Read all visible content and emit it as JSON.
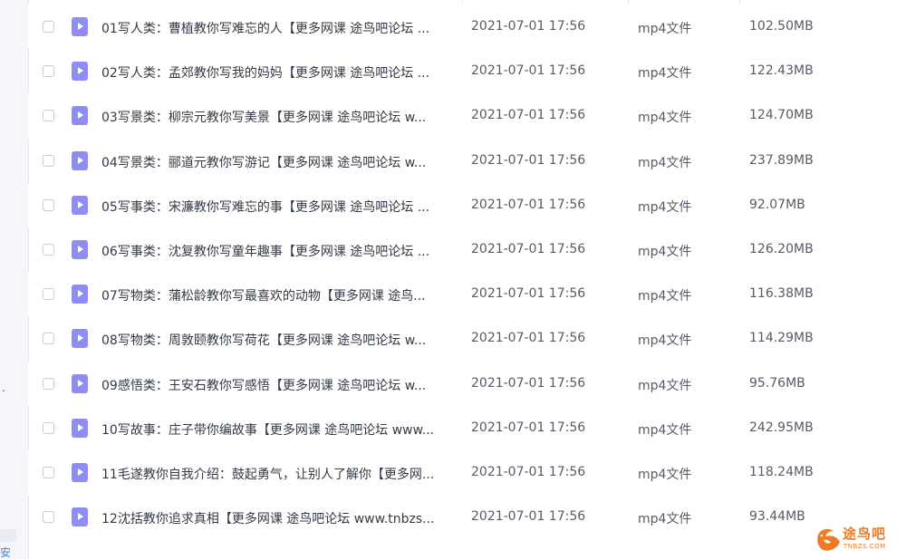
{
  "left_panel": {
    "dot": ".",
    "bottom_text": "安"
  },
  "files": [
    {
      "name": "01写人类：曹植教你写难忘的人【更多网课 途鸟吧论坛 ...",
      "date": "2021-07-01 17:56",
      "type": "mp4文件",
      "size": "102.50MB"
    },
    {
      "name": "02写人类：孟郊教你写我的妈妈【更多网课 途鸟吧论坛 ...",
      "date": "2021-07-01 17:56",
      "type": "mp4文件",
      "size": "122.43MB"
    },
    {
      "name": "03写景类：柳宗元教你写美景【更多网课 途鸟吧论坛 w...",
      "date": "2021-07-01 17:56",
      "type": "mp4文件",
      "size": "124.70MB"
    },
    {
      "name": "04写景类：郦道元教你写游记【更多网课 途鸟吧论坛 w...",
      "date": "2021-07-01 17:56",
      "type": "mp4文件",
      "size": "237.89MB"
    },
    {
      "name": "05写事类：宋濂教你写难忘的事【更多网课 途鸟吧论坛 ...",
      "date": "2021-07-01 17:56",
      "type": "mp4文件",
      "size": "92.07MB"
    },
    {
      "name": "06写事类：沈复教你写童年趣事【更多网课 途鸟吧论坛 ...",
      "date": "2021-07-01 17:56",
      "type": "mp4文件",
      "size": "126.20MB"
    },
    {
      "name": "07写物类：蒲松龄教你写最喜欢的动物【更多网课 途鸟...",
      "date": "2021-07-01 17:56",
      "type": "mp4文件",
      "size": "116.38MB"
    },
    {
      "name": "08写物类：周敦颐教你写荷花【更多网课 途鸟吧论坛 w...",
      "date": "2021-07-01 17:56",
      "type": "mp4文件",
      "size": "114.29MB"
    },
    {
      "name": "09感悟类：王安石教你写感悟【更多网课 途鸟吧论坛 w...",
      "date": "2021-07-01 17:56",
      "type": "mp4文件",
      "size": "95.76MB"
    },
    {
      "name": "10写故事：庄子带你编故事【更多网课 途鸟吧论坛 www...",
      "date": "2021-07-01 17:56",
      "type": "mp4文件",
      "size": "242.95MB"
    },
    {
      "name": "11毛遂教你自我介绍：鼓起勇气，让别人了解你【更多网...",
      "date": "2021-07-01 17:56",
      "type": "mp4文件",
      "size": "118.24MB"
    },
    {
      "name": "12沈括教你追求真相【更多网课 途鸟吧论坛 www.tnbzs...",
      "date": "2021-07-01 17:56",
      "type": "mp4文件",
      "size": "93.44MB"
    }
  ],
  "watermark": {
    "text": "途鸟吧",
    "sub": "TNBZS.COM",
    "color": "#f07a24"
  },
  "colors": {
    "file_icon": "#8f8cf4",
    "text": "#333a45"
  }
}
